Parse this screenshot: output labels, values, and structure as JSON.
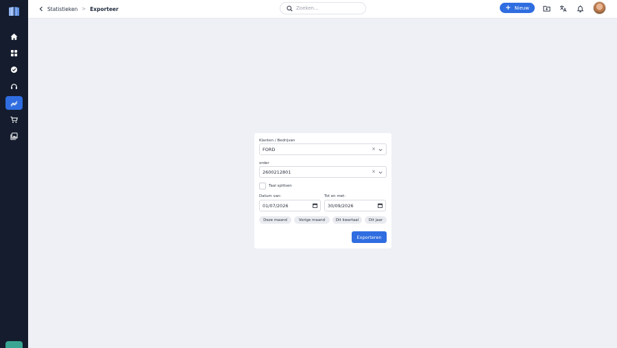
{
  "sidebar": {
    "logo": "book-logo",
    "items": [
      {
        "icon": "home-icon",
        "active": false
      },
      {
        "icon": "dashboard-grid-icon",
        "active": false
      },
      {
        "icon": "check-badge-icon",
        "active": false
      },
      {
        "icon": "headset-icon",
        "active": false
      },
      {
        "icon": "trend-chart-icon",
        "active": true
      },
      {
        "icon": "cart-icon",
        "active": false
      },
      {
        "icon": "gallery-icon",
        "active": false
      }
    ]
  },
  "topbar": {
    "breadcrumb": {
      "parent": "Statistieken",
      "separator": ">",
      "current": "Exporteer"
    },
    "search": {
      "placeholder": "Zoeken...",
      "value": ""
    },
    "new_button": {
      "label": "Nieuw"
    },
    "icons": [
      "folder-add-icon",
      "translate-icon",
      "bell-icon"
    ]
  },
  "export_form": {
    "client_label": "Klanten / Bedrijven",
    "client_value": "FORD",
    "order_label": "order",
    "order_value": "2600212801",
    "clear_symbol": "×",
    "split_language_label": "Taal splitsen",
    "split_language_checked": false,
    "date_from_label": "Datum van:",
    "date_from_value": "01/07/2026",
    "date_to_label": "Tot en met:",
    "date_to_value": "30/09/2026",
    "quick_ranges": [
      "Deze maand",
      "Vorige maand",
      "Dit kwartaal",
      "Dit jaar"
    ],
    "submit_label": "Exporteren"
  },
  "colors": {
    "sidebar_bg": "#141c2e",
    "accent": "#2f6de0",
    "page_bg": "#eef0f6",
    "bottom_badge": "#3aa592"
  }
}
